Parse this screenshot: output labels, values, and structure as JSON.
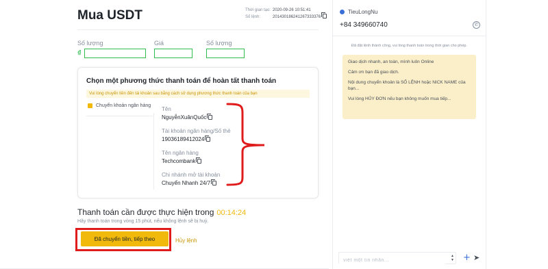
{
  "order": {
    "title": "Mua USDT",
    "created_label": "Thời gian tạo:",
    "created_value": "2020-09-26 10:51:41",
    "order_no_label": "Số lệnh:",
    "order_no_value": "201430186241267333376"
  },
  "fields": [
    {
      "label": "Số lượng",
      "value": ""
    },
    {
      "label": "Giá",
      "value": ""
    },
    {
      "label": "Số lượng",
      "value": ""
    }
  ],
  "currency_symbol": "₫",
  "payment_card": {
    "title": "Chọn một phương thức thanh toán để hoàn tất thanh toán",
    "notice": "Vui lòng chuyển tiền đến tài khoản sau bằng cách sử dụng phương thức thanh toán của bạn",
    "method": "Chuyển khoản ngân hàng",
    "details": [
      {
        "label": "Tên",
        "value": "NguyễnXuânQuốc"
      },
      {
        "label": "Tài khoản ngân hàng/Số thẻ",
        "value": "19036189412024"
      },
      {
        "label": "Tên ngân hàng",
        "value": "Techcombank"
      },
      {
        "label": "Chi nhánh mở tài khoản",
        "value": "Chuyển Nhanh 24/7"
      }
    ]
  },
  "payment": {
    "title": "Thanh toán cần được thực hiện trong",
    "timer": "00:14:24",
    "subtitle": "Hãy thanh toán trong vòng 15 phút, nếu không lệnh sẽ bị huỷ.",
    "confirm_label": "Đã chuyển tiền, tiếp theo",
    "cancel_label": "Hủy lệnh"
  },
  "chat": {
    "username": "TieuLongNu",
    "phone": "+84 349660740",
    "system_message": "Đã đặt lệnh thành công, vui lòng thanh toán trong thời gian cho phép.",
    "messages": [
      "Giao dịch nhanh, an toàn, mình luôn Online",
      "Cảm ơn bạn đã giao dịch.",
      "Nội dung chuyển khoản là SỐ LỆNH hoặc NICK NAME của bạn...",
      "Vui lòng HỦY ĐƠN nếu bạn không muốn mua tiếp..."
    ],
    "input_placeholder": "viết một tin nhắn...",
    "plus_icon": "+",
    "send_icon": "➤"
  },
  "colors": {
    "accent": "#f0b90b",
    "highlight_annotation": "#e01b1b",
    "field_border": "#2ebd51",
    "bubble": "#fbefc9"
  }
}
